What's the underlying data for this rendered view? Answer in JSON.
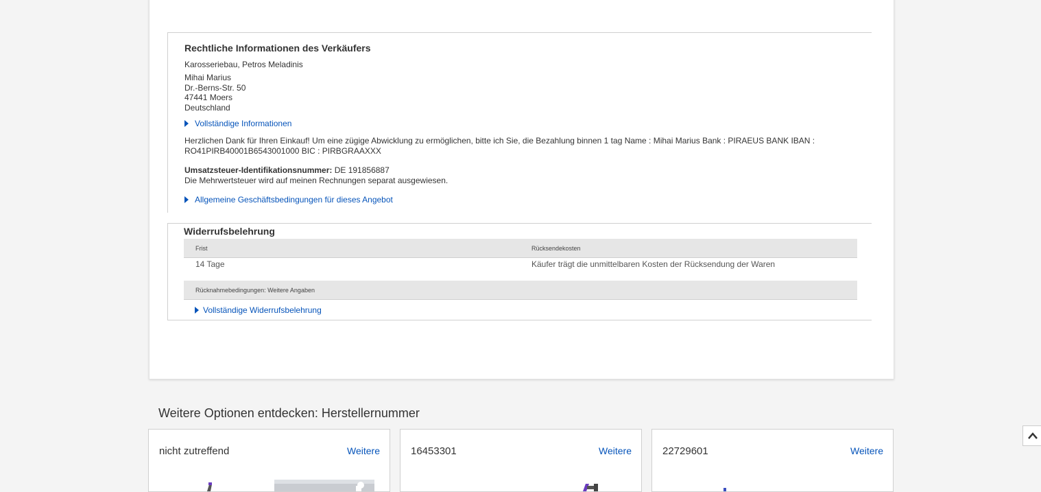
{
  "legal": {
    "title": "Rechtliche Informationen des Verkäufers",
    "company": "Karosseriebau, Petros Meladinis",
    "address": [
      "Mihai Marius",
      "Dr.-Berns-Str. 50",
      "47441 Moers",
      "Deutschland"
    ],
    "full_info_link": "Vollständige Informationen",
    "message_line1": "Herzlichen Dank für Ihren Einkauf! Um eine zügige Abwicklung zu ermöglichen, bitte ich Sie, die Bezahlung binnen 1 tag Name : Mihai Marius Bank : PIRAEUS BANK IBAN :",
    "message_line2": "RO41PIRB40001B6543001000 BIC : PIRBGRAAXXX",
    "vat_label": "Umsatzsteuer-Identifikationsnummer:",
    "vat_value": " DE 191856887",
    "vat_note": "Die Mehrwertsteuer wird auf meinen Rechnungen separat ausgewiesen.",
    "terms_link": "Allgemeine Geschäftsbedingungen für dieses Angebot"
  },
  "withdrawal": {
    "title": "Widerrufsbelehrung",
    "col_period": "Frist",
    "col_costs": "Rücksendekosten",
    "period_value": "14 Tage",
    "costs_value": "Käufer trägt die unmittelbaren Kosten der Rücksendung der Waren",
    "return_conditions": "Rücknahmebedingungen: Weitere Angaben",
    "full_link": "Vollständige Widerrufsbelehrung"
  },
  "explore": {
    "title": "Weitere Optionen entdecken: Herstellernummer",
    "cards": [
      {
        "title": "nicht zutreffend",
        "more": "Weitere"
      },
      {
        "title": "16453301",
        "more": "Weitere"
      },
      {
        "title": "22729601",
        "more": "Weitere"
      }
    ]
  },
  "colors": {
    "link": "#0654ba",
    "accent_purple": "#6a3bbf"
  },
  "icons": {
    "scroll_top": "chevron-up-icon",
    "expand": "triangle-right-icon"
  }
}
